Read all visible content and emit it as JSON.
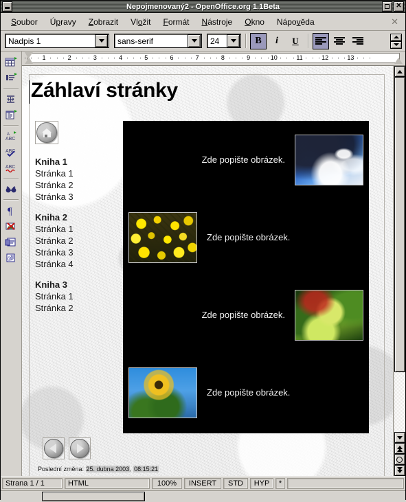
{
  "window": {
    "title": "Nepojmenovaný2 - OpenOffice.org 1.1Beta",
    "minimize_label": "_",
    "maximize_label": "□",
    "close_label": "✕"
  },
  "menubar": {
    "items": [
      {
        "label": "Soubor",
        "accel": "S"
      },
      {
        "label": "Úpravy",
        "accel": "p"
      },
      {
        "label": "Zobrazit",
        "accel": "Z"
      },
      {
        "label": "Vložit",
        "accel": "o"
      },
      {
        "label": "Formát",
        "accel": "F"
      },
      {
        "label": "Nástroje",
        "accel": "N"
      },
      {
        "label": "Okno",
        "accel": "O"
      },
      {
        "label": "Nápověda",
        "accel": "v"
      }
    ],
    "close_doc_label": "✕"
  },
  "toolbar": {
    "paragraph_style": "Nadpis 1",
    "font_name": "sans-serif",
    "font_size": "24",
    "bold_label": "B",
    "italic_label": "i",
    "underline_label": "U",
    "bold_active": true,
    "italic_active": false,
    "underline_active": false,
    "align_left_active": true,
    "align_center_active": false,
    "align_right_active": false
  },
  "ruler": {
    "numbers": [
      "1",
      "2",
      "3",
      "4",
      "5",
      "6",
      "7",
      "8",
      "9",
      "10",
      "11",
      "12",
      "13"
    ],
    "unit": "cm"
  },
  "left_toolbar": {
    "items": [
      {
        "name": "insert-table-icon"
      },
      {
        "name": "insert-text-frame-icon"
      },
      {
        "name": "insert-horizontal-line-icon"
      },
      {
        "name": "insert-object-icon"
      },
      {
        "name": "autospellcheck-icon"
      },
      {
        "name": "spellcheck-icon"
      },
      {
        "name": "spellcheck-wave-icon"
      },
      {
        "name": "find-replace-icon"
      },
      {
        "name": "formatting-marks-icon"
      },
      {
        "name": "graphics-off-icon"
      },
      {
        "name": "web-layout-icon"
      },
      {
        "name": "online-source-icon"
      }
    ]
  },
  "document": {
    "heading": "Záhlaví stránky",
    "home_button_name": "home-button",
    "nav_prev_label": "◀",
    "nav_next_label": "▶",
    "toc": [
      {
        "book": "Kniha 1",
        "pages": [
          "Stránka 1",
          "Stránka 2",
          "Stránka 3"
        ]
      },
      {
        "book": "Kniha 2",
        "pages": [
          "Stránka 1",
          "Stránka 2",
          "Stránka 3",
          "Stránka 4"
        ]
      },
      {
        "book": "Kniha 3",
        "pages": [
          "Stránka 1",
          "Stránka 2"
        ]
      }
    ],
    "gallery": {
      "background_color": "#000000",
      "rows": [
        {
          "caption": "Zde popište obrázek.",
          "image": "clouds-photo",
          "image_side": "right"
        },
        {
          "caption": "Zde popište obrázek.",
          "image": "yellow-flowers-photo",
          "image_side": "left"
        },
        {
          "caption": "Zde popište obrázek.",
          "image": "green-apples-photo",
          "image_side": "right"
        },
        {
          "caption": "Zde popište obrázek.",
          "image": "sunflower-photo",
          "image_side": "left"
        }
      ]
    },
    "footer": {
      "label": "Poslední změna: ",
      "date": "25. dubna 2003",
      "separator": ", ",
      "time": "08:15:21"
    }
  },
  "statusbar": {
    "page": "Strana 1 / 1",
    "mode": "HTML",
    "zoom": "100%",
    "insert": "INSERT",
    "selection": "STD",
    "hyperlink": "HYP",
    "modified": "*"
  }
}
